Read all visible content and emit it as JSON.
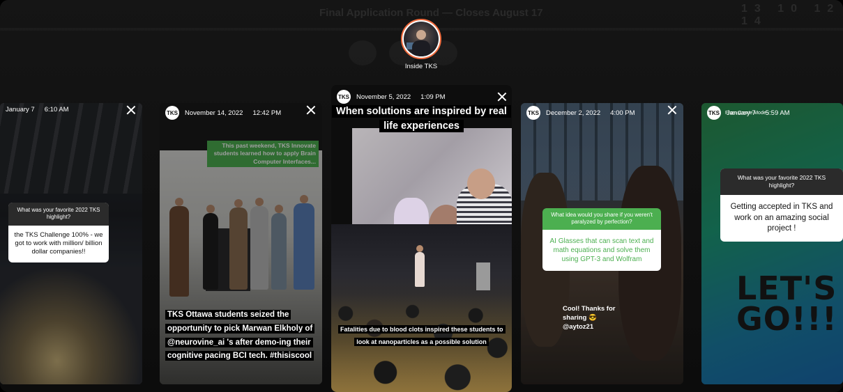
{
  "background": {
    "banner": "Final Application Round — Closes August 17",
    "counter": "13  10  12  14"
  },
  "highlight": {
    "label": "Inside TKS"
  },
  "stories": [
    {
      "date": "January 7",
      "time": "6:10 AM",
      "question": "What was your favorite 2022 TKS highlight?",
      "answer": "the TKS Challenge 100% - we got to work with million/ billion dollar companies!!"
    },
    {
      "date": "November 14, 2022",
      "time": "12:42 PM",
      "green_text": "This past weekend, TKS Innovate students learned how to apply Brain Computer Interfaces...",
      "caption": "TKS Ottawa students seized the opportunity to pick Marwan Elkholy of @neurovine_ai 's after demo-ing their cognitive pacing BCI tech. #thisiscool"
    },
    {
      "date": "November 5, 2022",
      "time": "1:09 PM",
      "title": "When solutions are inspired by real life experiences",
      "caption": "Fatalities due to blood clots inspired these students to look at nanoparticles as a possible solution"
    },
    {
      "date": "December 2, 2022",
      "time": "4:00 PM",
      "question": "What idea would you share if you weren't paralyzed by perfection?",
      "answer": "AI Glasses that can scan text and math equations and solve them using GPT-3 and Wolfram",
      "reply": "Cool! Thanks for sharing 😎 @aytoz21"
    },
    {
      "date": "January 7",
      "time": "5:59 AM",
      "subtitle": "From Create Mode ›",
      "question": "What was your favorite 2022 TKS highlight?",
      "answer": "Getting accepted in TKS and work on an amazing social project !",
      "sticker": "LET'S GO!!!"
    }
  ],
  "logo_text": "TKS",
  "colors": {
    "accent_green": "#4caf50",
    "ring_orange": "#f06a3c"
  }
}
